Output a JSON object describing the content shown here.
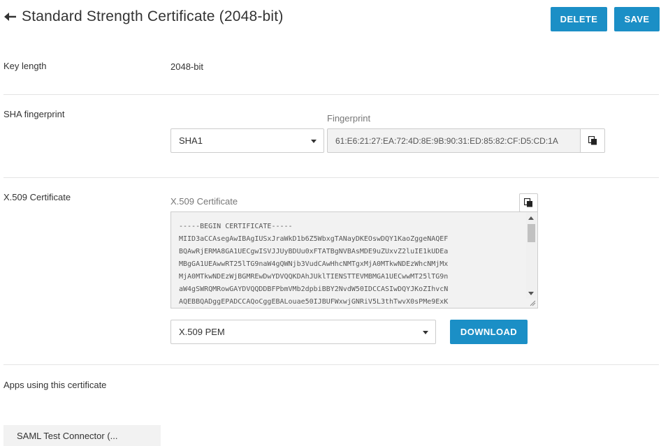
{
  "header": {
    "title": "Standard Strength Certificate (2048-bit)",
    "delete_label": "DELETE",
    "save_label": "SAVE"
  },
  "key_length": {
    "label": "Key length",
    "value": "2048-bit"
  },
  "sha_fingerprint": {
    "label": "SHA fingerprint",
    "algorithm": "SHA1",
    "fingerprint_label": "Fingerprint",
    "fingerprint_value": "61:E6:21:27:EA:72:4D:8E:9B:90:31:ED:85:82:CF:D5:CD:1A"
  },
  "certificate": {
    "label": "X.509 Certificate",
    "field_label": "X.509 Certificate",
    "content": "-----BEGIN CERTIFICATE-----\nMIID3aCCAsegAwIBAgIUSxJraWkD1b6Z5WbxgTANayDKEOswDQY1KaoZggeNAQEF\nBQAwRjERMA8GA1UECgwISVJJUyBDUu0xFTATBgNVBAsMDE9uZUxvZ2luIE1kUDEa\nMBgGA1UEAwwRT25lTG9naW4gQWNjb3VudCAwHhcNMTgxMjA0MTkwNDEzWhcNMjMx\nMjA0MTkwNDEzWjBGMREwDwYDVQQKDAhJUklTIENSTTEVMBMGA1UECwwMT25lTG9n\naW4gSWRQMRowGAYDVQQDDBFPbmVMb2dpbiBBY2NvdW50IDCCASIwDQYJKoZIhvcN\nAQEBBQADggEPADCCAQoCggEBALouae50IJBUFWxwjGNRiV5L3thTwvX0sPMe9ExK",
    "format": "X.509 PEM",
    "download_label": "DOWNLOAD"
  },
  "apps": {
    "label": "Apps using this certificate",
    "items": [
      "SAML Test Connector (..."
    ]
  },
  "icons": {
    "back": "arrow-left-icon",
    "copy": "copy-icon",
    "dropdown": "chevron-down-icon"
  },
  "colors": {
    "primary": "#1b8fc6",
    "divider": "#e4e4e4",
    "input_readonly_bg": "#f2f2f2"
  }
}
